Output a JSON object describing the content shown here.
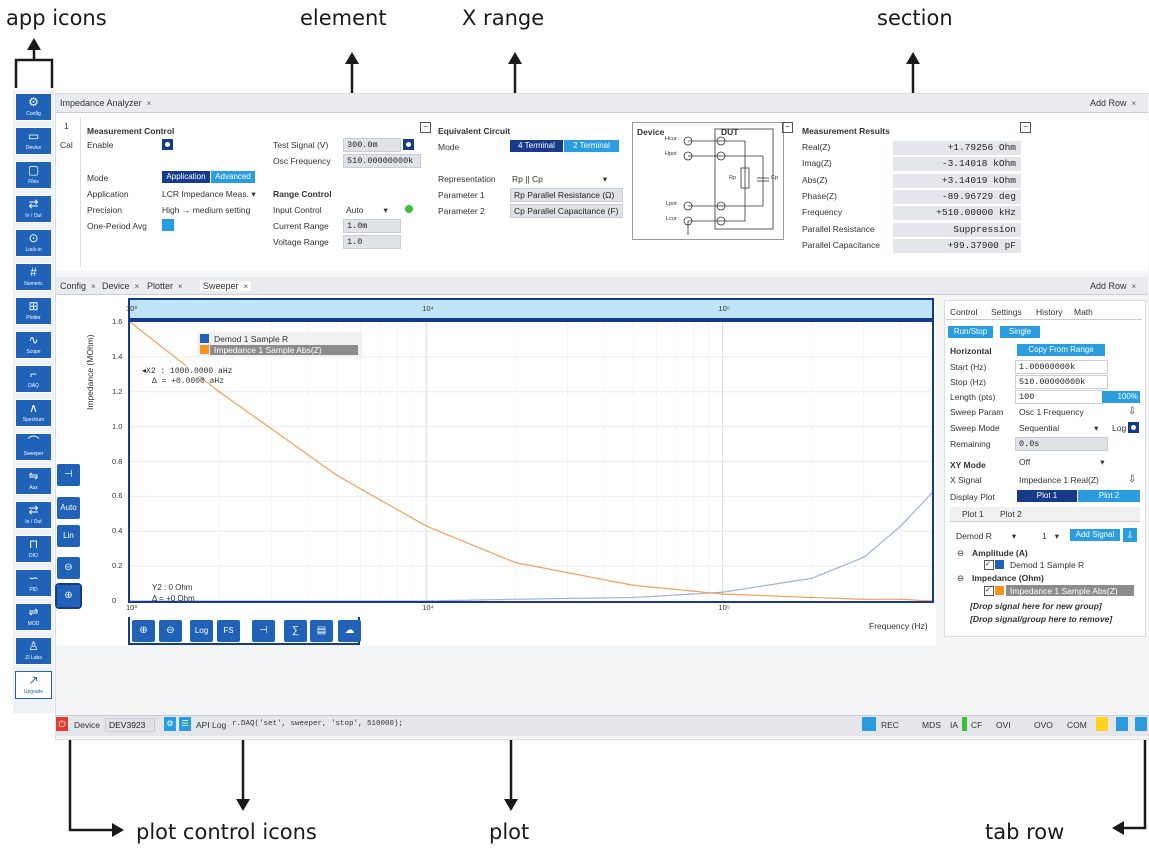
{
  "callouts": {
    "app_icons": "app icons",
    "element": "element",
    "x_range": "X range",
    "section": "section",
    "plot_control_icons": "plot control icons",
    "plot": "plot",
    "tab_row": "tab row"
  },
  "top_tabs": {
    "impedance": "Impedance Analyzer",
    "add_row": "Add Row"
  },
  "measurement_control": {
    "index": "1",
    "cal": "Cal",
    "title": "Measurement Control",
    "enable": "Enable",
    "test_signal_label": "Test Signal (V)",
    "test_signal_value": "300.0m",
    "osc_freq_label": "Osc Frequency",
    "osc_freq_value": "510.00000000k",
    "mode": "Mode",
    "mode_application": "Application",
    "mode_advanced": "Advanced",
    "application": "Application",
    "application_value": "LCR Impedance Meas.",
    "precision": "Precision",
    "precision_value": "High → medium setting",
    "one_period_avg": "One-Period Avg",
    "range_control": "Range Control",
    "input_control": "Input Control",
    "input_control_value": "Auto",
    "current_range": "Current Range",
    "current_range_value": "1.0m",
    "voltage_range": "Voltage Range",
    "voltage_range_value": "1.0"
  },
  "equivalent_circuit": {
    "title": "Equivalent Circuit",
    "mode": "Mode",
    "mode_4terminal": "4 Terminal",
    "mode_2terminal": "2 Terminal",
    "representation": "Representation",
    "representation_value": "Rp || Cp",
    "parameter1": "Parameter 1",
    "parameter1_value": "Rp Parallel Resistance (Ω)",
    "parameter2": "Parameter 2",
    "parameter2_value": "Cp Parallel Capacitance (F)"
  },
  "device_diagram": {
    "device": "Device",
    "dut": "DUT",
    "hcur": "Hcur",
    "hpot": "Hpot",
    "lpot": "Lpot",
    "lcur": "Lcur",
    "rp": "Rp",
    "cp": "Cp"
  },
  "measurement_results": {
    "title": "Measurement Results",
    "rows": [
      {
        "label": "Real(Z)",
        "value": "+1.79256 Ohm"
      },
      {
        "label": "Imag(Z)",
        "value": "-3.14018 kOhm"
      },
      {
        "label": "Abs(Z)",
        "value": "+3.14019 kOhm"
      },
      {
        "label": "Phase(Z)",
        "value": "-89.96729 deg"
      },
      {
        "label": "Frequency",
        "value": "+510.00000 kHz"
      },
      {
        "label": "Parallel Resistance",
        "value": "Suppression"
      },
      {
        "label": "Parallel Capacitance",
        "value": "+99.37900 pF"
      }
    ]
  },
  "bottom_tabs": [
    "Config",
    "Device",
    "Plotter",
    "Sweeper"
  ],
  "bottom_add_row": "Add Row",
  "app_icons": [
    {
      "icon": "gear-icon",
      "label": "Config"
    },
    {
      "icon": "device-icon",
      "label": "Device"
    },
    {
      "icon": "files-icon",
      "label": "Files"
    },
    {
      "icon": "in-out-icon",
      "label": "In / Out"
    },
    {
      "icon": "lockin-icon",
      "label": "Lock-in"
    },
    {
      "icon": "numeric-icon",
      "label": "Numeric"
    },
    {
      "icon": "plotter-icon",
      "label": "Plotter"
    },
    {
      "icon": "scope-icon",
      "label": "Scope"
    },
    {
      "icon": "daq-icon",
      "label": "DAQ"
    },
    {
      "icon": "spectrum-icon",
      "label": "Spectrum"
    },
    {
      "icon": "sweeper-icon",
      "label": "Sweeper"
    },
    {
      "icon": "aux-icon",
      "label": "Aux"
    },
    {
      "icon": "in-out-2-icon",
      "label": "In / Out"
    },
    {
      "icon": "dio-icon",
      "label": "DIO"
    },
    {
      "icon": "pid-icon",
      "label": "PID"
    },
    {
      "icon": "mod-icon",
      "label": "MOD"
    },
    {
      "icon": "zi-labs-icon",
      "label": "ZI Labs"
    },
    {
      "icon": "upgrade-icon",
      "label": "Upgrade"
    }
  ],
  "plot": {
    "y_axis_label": "Impedance (MOhm)",
    "x_axis_label": "Frequency (Hz)",
    "legend": [
      "Demod 1 Sample R",
      "Impedance 1 Sample Abs(Z)"
    ],
    "cursor_x": "X2 : 1000.0000 aHz",
    "cursor_dx": "Δ = +0.0000 aHz",
    "cursor_y": "Y2 : 0 Ohm",
    "cursor_dy": "Δ = +0 Ohm",
    "y_ticks": [
      "1.6",
      "1.4",
      "1.2",
      "1.0",
      "0.8",
      "0.6",
      "0.4",
      "0.2",
      "0"
    ],
    "x_ticks": [
      "10³",
      "10⁴",
      "10⁵"
    ],
    "range_ticks": [
      "10³",
      "10⁴",
      "10⁵"
    ]
  },
  "chart_data": {
    "type": "line",
    "title": "",
    "xlabel": "Frequency (Hz)",
    "ylabel": "Impedance (MOhm)",
    "x_scale": "log",
    "xlim": [
      1000,
      510000
    ],
    "ylim": [
      0,
      1.6
    ],
    "x": [
      1000,
      2000,
      5000,
      10000,
      20000,
      50000,
      100000,
      200000,
      300000,
      400000,
      510000
    ],
    "series": [
      {
        "name": "Demod 1 Sample R",
        "color": "#9fb3d9",
        "values": [
          0.0,
          0.0,
          0.0,
          0.0,
          0.01,
          0.02,
          0.05,
          0.13,
          0.25,
          0.43,
          0.62
        ]
      },
      {
        "name": "Impedance 1 Sample Abs(Z)",
        "color": "#f0a25a",
        "values": [
          1.6,
          1.2,
          0.72,
          0.43,
          0.22,
          0.09,
          0.04,
          0.02,
          0.01,
          0.01,
          0.0
        ]
      }
    ],
    "grid": true,
    "legend": "top-left"
  },
  "plot_tools": [
    {
      "icon": "zoom-in-icon",
      "text": ""
    },
    {
      "icon": "zoom-out-icon",
      "text": ""
    },
    {
      "icon": "log-icon",
      "text": "Log"
    },
    {
      "icon": "fs-icon",
      "text": "FS"
    },
    {
      "icon": "cursor-icon",
      "text": ""
    },
    {
      "icon": "math-icon",
      "text": ""
    },
    {
      "icon": "export-icon",
      "text": ""
    },
    {
      "icon": "cloud-icon",
      "text": ""
    }
  ],
  "left_tools": [
    {
      "icon": "cursor-tool-icon",
      "text": ""
    },
    {
      "icon": "auto-scale-icon",
      "text": "Auto"
    },
    {
      "icon": "lin-icon",
      "text": "Lin"
    },
    {
      "icon": "zoom-out-left-icon",
      "text": ""
    },
    {
      "icon": "zoom-in-left-icon",
      "text": ""
    }
  ],
  "sweeper": {
    "tabs": [
      "Control",
      "Settings",
      "History",
      "Math"
    ],
    "run_stop": "Run/Stop",
    "single": "Single",
    "horizontal": "Horizontal",
    "copy_from_range": "Copy From Range",
    "start_label": "Start (Hz)",
    "start_value": "1.00000000k",
    "stop_label": "Stop (Hz)",
    "stop_value": "510.00000000k",
    "length_label": "Length (pts)",
    "length_value": "100",
    "progress": "100%",
    "sweep_param_label": "Sweep Param",
    "sweep_param_value": "Osc 1 Frequency",
    "sweep_mode_label": "Sweep Mode",
    "sweep_mode_value": "Sequential",
    "log_label": "Log",
    "remaining_label": "Remaining",
    "remaining_value": "0.0s",
    "xy_mode": "XY Mode",
    "xy_mode_value": "Off",
    "x_signal_label": "X Signal",
    "x_signal_value": "Impedance 1 Real(Z)",
    "display_plot": "Display Plot",
    "plot1": "Plot 1",
    "plot2": "Plot 2",
    "sub_plot1": "Plot 1",
    "sub_plot2": "Plot 2",
    "demod_select": "Demod R",
    "demod_index": "1",
    "add_signal": "Add Signal",
    "group_amplitude": "Amplitude (A)",
    "signal_demod": "Demod 1 Sample R",
    "group_impedance": "Impedance (Ohm)",
    "signal_impedance": "Impedance 1 Sample Abs(Z)",
    "drop_new": "[Drop signal here for new group]",
    "drop_remove": "[Drop signal/group here to remove]"
  },
  "status_bar": {
    "device_label": "Device",
    "device_value": "DEV3923",
    "api_log": "API Log",
    "command": "r.DAQ('set', sweeper, 'stop', 510000);",
    "rec": "REC",
    "mds": "MDS",
    "ia": "IA",
    "cf": "CF",
    "ovi": "OVI",
    "ovo": "OVO",
    "com": "COM"
  }
}
